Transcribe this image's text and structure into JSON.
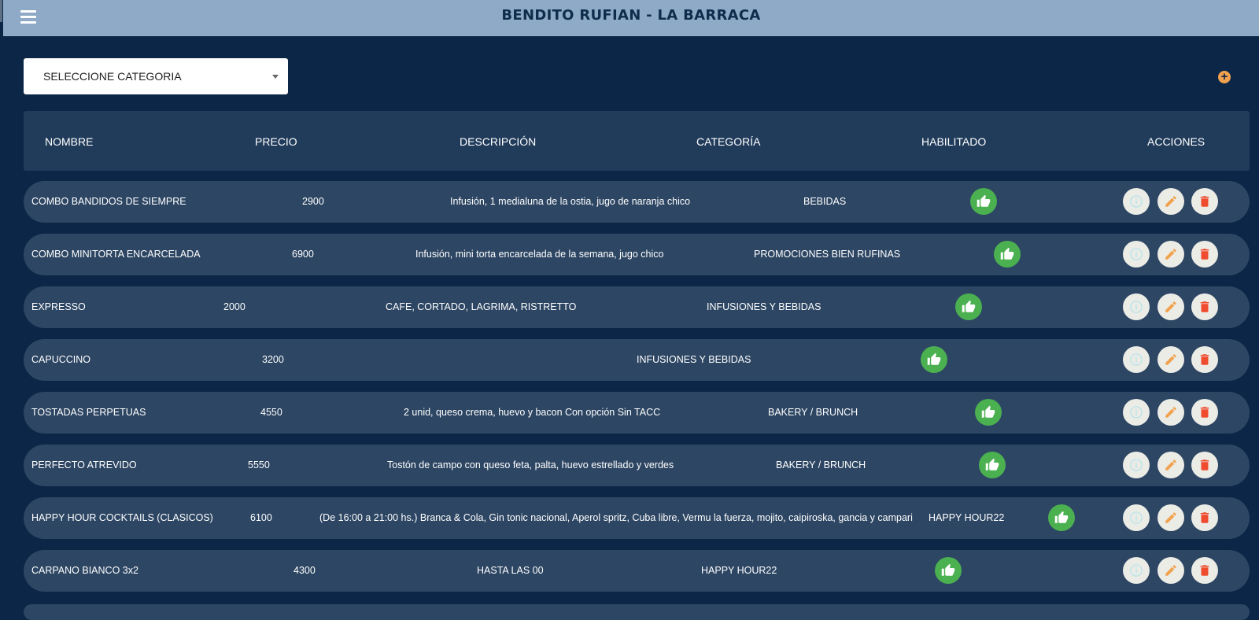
{
  "header": {
    "title": "BENDITO RUFIAN - LA BARRACA"
  },
  "filter": {
    "category_label": "SELECCIONE CATEGORIA"
  },
  "table": {
    "columns": [
      "NOMBRE",
      "PRECIO",
      "DESCRIPCIÓN",
      "CATEGORÍA",
      "HABILITADO",
      "ACCIONES"
    ],
    "rows": [
      {
        "nombre": "COMBO BANDIDOS DE SIEMPRE",
        "precio": "2900",
        "descripcion": "Infusión, 1 medialuna de la ostia, jugo de naranja chico",
        "categoria": "BEBIDAS",
        "habilitado": true
      },
      {
        "nombre": "COMBO MINITORTA ENCARCELADA",
        "precio": "6900",
        "descripcion": "Infusión, mini torta encarcelada de la semana, jugo chico",
        "categoria": "PROMOCIONES BIEN RUFINAS",
        "habilitado": true
      },
      {
        "nombre": "EXPRESSO",
        "precio": "2000",
        "descripcion": "CAFE, CORTADO, LAGRIMA, RISTRETTO",
        "categoria": "INFUSIONES Y BEBIDAS",
        "habilitado": true
      },
      {
        "nombre": "CAPUCCINO",
        "precio": "3200",
        "descripcion": "",
        "categoria": "INFUSIONES Y BEBIDAS",
        "habilitado": true
      },
      {
        "nombre": "TOSTADAS PERPETUAS",
        "precio": "4550",
        "descripcion": "2 unid, queso crema, huevo y bacon Con opción Sin TACC",
        "categoria": "BAKERY / BRUNCH",
        "habilitado": true
      },
      {
        "nombre": "PERFECTO ATREVIDO",
        "precio": "5550",
        "descripcion": "Tostón de campo con queso feta, palta, huevo estrellado y verdes",
        "categoria": "BAKERY / BRUNCH",
        "habilitado": true
      },
      {
        "nombre": "HAPPY HOUR COCKTAILS (CLASICOS)",
        "precio": "6100",
        "descripcion": "(De 16:00 a 21:00 hs.) Branca & Cola, Gin tonic nacional, Aperol spritz, Cuba libre, Vermu la fuerza, mojito, caipiroska, gancia y campari",
        "categoria": "HAPPY HOUR22",
        "habilitado": true
      },
      {
        "nombre": "CARPANO BIANCO 3x2",
        "precio": "4300",
        "descripcion": "HASTA LAS 00",
        "categoria": "HAPPY HOUR22",
        "habilitado": true
      }
    ]
  },
  "icons": {
    "menu": "hamburger-menu-icon",
    "dropdown": "chevron-down-icon",
    "add": "plus-circle-icon",
    "enabled": "thumbs-up-icon",
    "info": "info-circle-icon",
    "edit": "pencil-icon",
    "delete": "trash-icon"
  },
  "colors": {
    "background": "#0c2647",
    "topbar": "#8eaac6",
    "title": "#0f2c4c",
    "row": "#2d4663",
    "header_row": "#213c5b",
    "enabled_green": "#4bb050",
    "action_bg": "#ecece7",
    "info": "#b8e3e8",
    "edit": "#f0a24e",
    "delete": "#ef4b2e",
    "add": "#f0a24e"
  }
}
